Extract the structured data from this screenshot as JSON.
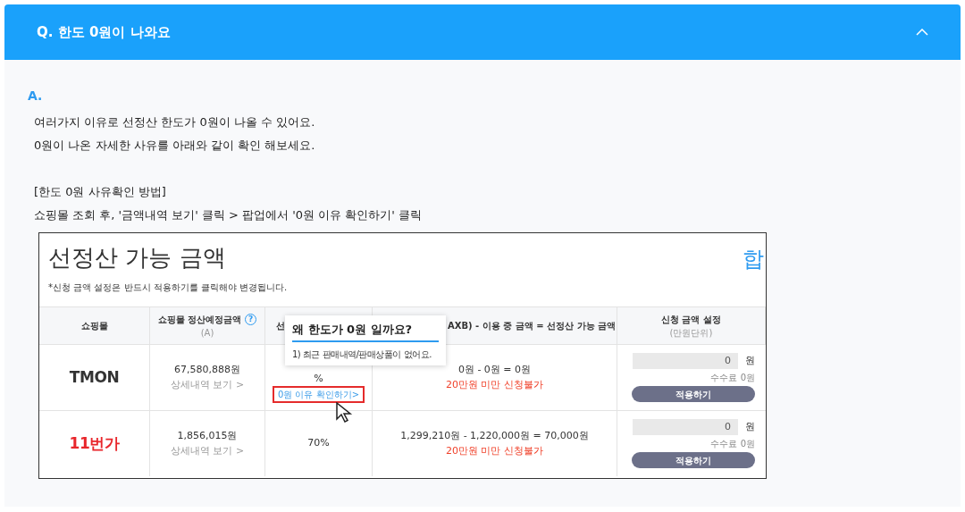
{
  "faq": {
    "question": "Q. 한도 0원이 나와요",
    "expanded": true,
    "answer_label": "A.",
    "answer_paragraphs": [
      [
        "여러가지 이유로 선정산 한도가 0원이 나올 수 있어요.",
        "0원이 나온 자세한 사유를 아래와 같이 확인 해보세요."
      ],
      [
        "[한도 0원 사유확인 방법]",
        "쇼핑몰 조회 후, '금액내역 보기' 클릭 > 팝업에서 '0원 이유 확인하기' 클릭"
      ]
    ]
  },
  "screenshot": {
    "title": "선정산 가능 금액",
    "note": "*신청 금액 설정은 반드시 적용하기를 클릭해야 변경됩니다.",
    "cut_text": "합",
    "columns": [
      {
        "label": "쇼핑몰"
      },
      {
        "label": "쇼핑몰 정산예정금액",
        "sub": "(A)",
        "help": "?"
      },
      {
        "label": "선"
      },
      {
        "label": "AXB) - 이용 중 금액 = 선정산 가능 금액"
      },
      {
        "label": "신청 금액 설정",
        "sub": "(만원단위)"
      }
    ],
    "rows": [
      {
        "mall": "TMON",
        "color": "#333333",
        "amount": "67,580,888원",
        "detail": "상세내역 보기 >",
        "rate": "%",
        "reason_link": "0원 이유 확인하기>",
        "highlighted": true,
        "formula": "0원 - 0원 = 0원",
        "warning": "20만원 미만 신청불가",
        "input": "0",
        "unit": "원",
        "fee": "수수료 0원",
        "apply": "적용하기"
      },
      {
        "mall": "11번가",
        "color": "#e8262b",
        "amount": "1,856,015원",
        "detail": "상세내역 보기 >",
        "rate": "70%",
        "formula": "1,299,210원 - 1,220,000원 = 70,000원",
        "warning": "20만원 미만 신청불가",
        "input": "0",
        "unit": "원",
        "fee": "수수료 0원",
        "apply": "적용하기"
      }
    ],
    "popup": {
      "title": "왜 한도가 0원 일까요?",
      "text": "1) 최근 판매내역/판매상품이 없어요."
    }
  }
}
